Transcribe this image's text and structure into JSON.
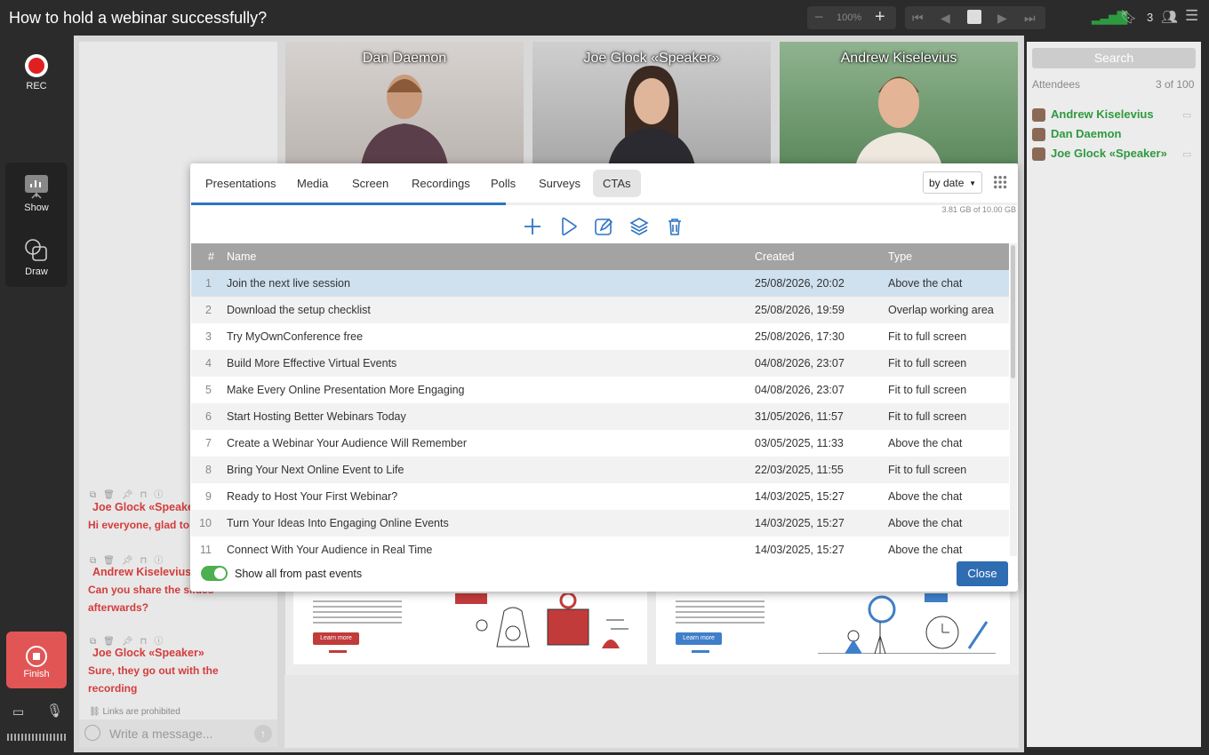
{
  "window": {
    "title": "How to hold a webinar successfully?",
    "zoom": "100%",
    "attendee_count": "3"
  },
  "rail": {
    "rec": "REC",
    "show": "Show",
    "draw": "Draw",
    "finish": "Finish"
  },
  "videos": [
    {
      "name": "Dan Daemon"
    },
    {
      "name": "Joe Glock «Speaker»"
    },
    {
      "name": "Andrew Kiselevius"
    }
  ],
  "chat": {
    "messages": [
      {
        "author": "Joe Glock «Speaker»",
        "text": "Hi everyone, glad to"
      },
      {
        "author": "Andrew Kiselevius",
        "text": "Can you share the slides afterwards?"
      },
      {
        "author": "Joe Glock «Speaker»",
        "text": "Sure, they go out with the recording"
      }
    ],
    "links_note": "Links are prohibited",
    "input_placeholder": "Write a message..."
  },
  "slides": {
    "button": "Learn more",
    "colors": {
      "left": "#c23b3b",
      "right": "#3f7fc9"
    }
  },
  "attendees": {
    "search_placeholder": "Search",
    "label": "Attendees",
    "count": "3 of 100",
    "list": [
      {
        "name": "Andrew Kiselevius"
      },
      {
        "name": "Dan Daemon"
      },
      {
        "name": "Joe Glock «Speaker»"
      }
    ]
  },
  "modal": {
    "tabs": [
      "Presentations",
      "Media",
      "Screen",
      "Recordings",
      "Polls",
      "Surveys",
      "CTAs"
    ],
    "active_tab": "CTAs",
    "sort": "by date",
    "storage": "3.81 GB of 10.00 GB",
    "columns": {
      "num": "#",
      "name": "Name",
      "created": "Created",
      "type": "Type"
    },
    "rows": [
      {
        "num": "1",
        "name": "Join the next live session",
        "created": "25/08/2026, 20:02",
        "type": "Above the chat"
      },
      {
        "num": "2",
        "name": "Download the setup checklist",
        "created": "25/08/2026, 19:59",
        "type": "Overlap working area"
      },
      {
        "num": "3",
        "name": "Try MyOwnConference free",
        "created": "25/08/2026, 17:30",
        "type": "Fit to full screen"
      },
      {
        "num": "4",
        "name": "Build More Effective Virtual Events",
        "created": "04/08/2026, 23:07",
        "type": "Fit to full screen"
      },
      {
        "num": "5",
        "name": "Make Every Online Presentation More Engaging",
        "created": "04/08/2026, 23:07",
        "type": "Fit to full screen"
      },
      {
        "num": "6",
        "name": "Start Hosting Better Webinars Today",
        "created": "31/05/2026, 11:57",
        "type": "Fit to full screen"
      },
      {
        "num": "7",
        "name": "Create a Webinar Your Audience Will Remember",
        "created": "03/05/2025, 11:33",
        "type": "Above the chat"
      },
      {
        "num": "8",
        "name": "Bring Your Next Online Event to Life",
        "created": "22/03/2025, 11:55",
        "type": "Fit to full screen"
      },
      {
        "num": "9",
        "name": "Ready to Host Your First Webinar?",
        "created": "14/03/2025, 15:27",
        "type": "Above the chat"
      },
      {
        "num": "10",
        "name": "Turn Your Ideas Into Engaging Online Events",
        "created": "14/03/2025, 15:27",
        "type": "Above the chat"
      },
      {
        "num": "11",
        "name": "Connect With Your Audience in Real Time",
        "created": "14/03/2025, 15:27",
        "type": "Above the chat"
      }
    ],
    "toggle_label": "Show all from past events",
    "toggle_on": true,
    "close": "Close",
    "accent": "#2f74c0"
  }
}
